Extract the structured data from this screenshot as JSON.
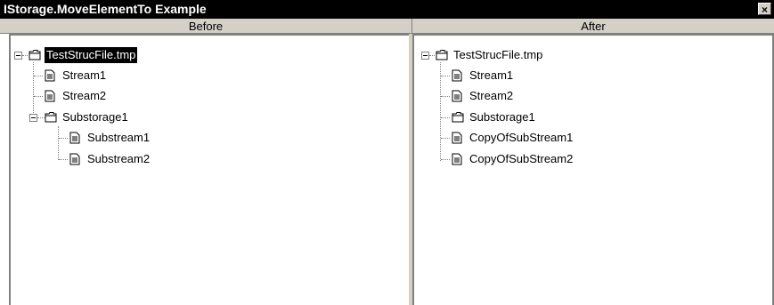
{
  "window": {
    "title": "IStorage.MoveElementTo Example",
    "close_label": "×"
  },
  "before": {
    "header": "Before",
    "root": "TestStrucFile.tmp",
    "items": [
      "Stream1",
      "Stream2",
      "Substorage1"
    ],
    "sub_items": [
      "Substream1",
      "Substream2"
    ]
  },
  "after": {
    "header": "After",
    "root": "TestStrucFile.tmp",
    "items": [
      "Stream1",
      "Stream2",
      "Substorage1",
      "CopyOfSubStream1",
      "CopyOfSubStream2"
    ]
  },
  "icons": {
    "folder": "folder-icon",
    "document": "document-icon",
    "collapse": "minus-box-icon"
  }
}
